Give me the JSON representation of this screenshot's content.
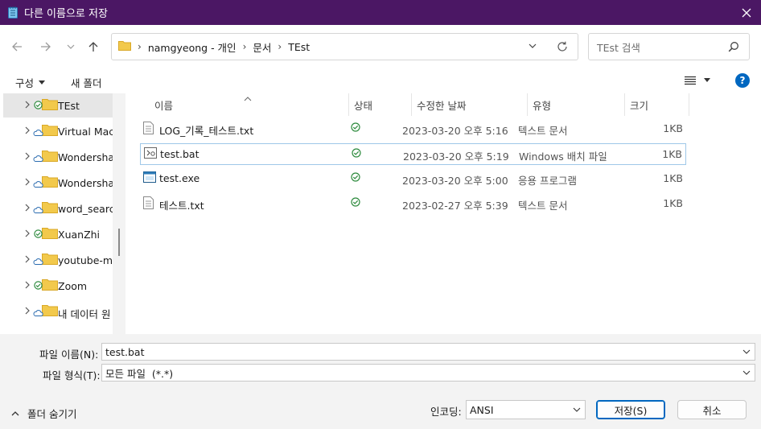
{
  "window": {
    "title": "다른 이름으로 저장"
  },
  "address": {
    "crumbs": [
      "namgyeong - 개인",
      "문서",
      "TEst"
    ]
  },
  "search": {
    "placeholder": "TEst 검색"
  },
  "toolbar": {
    "organize": "구성",
    "new_folder": "새 폴더"
  },
  "sidebar": {
    "items": [
      {
        "label": "TEst",
        "status": "ok",
        "selected": true
      },
      {
        "label": "Virtual Mach",
        "status": "cloud"
      },
      {
        "label": "Wondershare",
        "status": "cloud"
      },
      {
        "label": "Wondershare",
        "status": "cloud"
      },
      {
        "label": "word_search",
        "status": "cloud"
      },
      {
        "label": "XuanZhi",
        "status": "ok"
      },
      {
        "label": "youtube-mu",
        "status": "cloud"
      },
      {
        "label": "Zoom",
        "status": "ok"
      },
      {
        "label": "내 데이터 원",
        "status": "cloud"
      }
    ]
  },
  "columns": {
    "name": "이름",
    "status": "상태",
    "modified": "수정한 날짜",
    "type": "유형",
    "size": "크기"
  },
  "files": [
    {
      "name": "LOG_기록_테스트.txt",
      "icon": "text-file-icon",
      "modified": "2023-03-20 오후 5:16",
      "type": "텍스트 문서",
      "size": "1KB"
    },
    {
      "name": "test.bat",
      "icon": "batch-file-icon",
      "modified": "2023-03-20 오후 5:19",
      "type": "Windows 배치 파일",
      "size": "1KB",
      "selected": true
    },
    {
      "name": "test.exe",
      "icon": "exe-file-icon",
      "modified": "2023-03-20 오후 5:00",
      "type": "응용 프로그램",
      "size": "1KB"
    },
    {
      "name": "테스트.txt",
      "icon": "text-file-icon",
      "modified": "2023-02-27 오후 5:39",
      "type": "텍스트 문서",
      "size": "1KB"
    }
  ],
  "form": {
    "filename_label": "파일 이름(N):",
    "filename_value": "test.bat",
    "filetype_label": "파일 형식(T):",
    "filetype_value": "모든 파일  (*.*)",
    "hide_folders": "폴더 숨기기",
    "encoding_label": "인코딩:",
    "encoding_value": "ANSI",
    "save": "저장(S)",
    "cancel": "취소"
  },
  "colors": {
    "titlebar": "#4b1764",
    "accent": "#0067c0",
    "folder": "#f2c94c",
    "sync_ok": "#2e8b3e"
  }
}
